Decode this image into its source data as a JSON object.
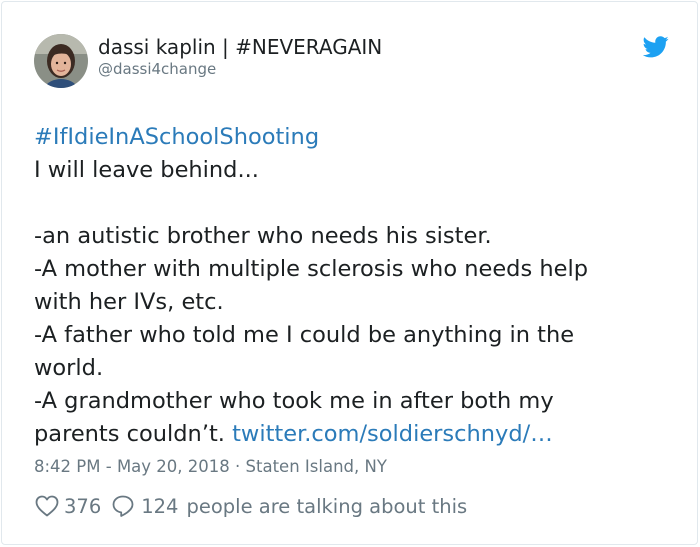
{
  "user": {
    "display_name": "dassi kaplin | #NEVERAGAIN",
    "handle": "@dassi4change"
  },
  "tweet": {
    "hashtag": "#IfIdieInASchoolShooting",
    "line1": "I will leave behind...",
    "line2": "-an autistic brother who needs his sister.",
    "line3": "-A mother with multiple sclerosis who needs help",
    "line4": "with her IVs, etc.",
    "line5": "-A father who told me I could be anything in the",
    "line6": "world.",
    "line7": "-A grandmother who took me in after both my",
    "line8_text": "parents couldn’t.",
    "link": "twitter.com/soldierschnyd/…"
  },
  "meta": {
    "time": "8:42 PM",
    "separator": " - ",
    "date": "May 20, 2018",
    "dot": " · ",
    "location": "Staten Island, NY"
  },
  "actions": {
    "like_count": "376",
    "reply_count": "124",
    "talking_text": "people are talking about this"
  },
  "icons": {
    "like": "heart-icon",
    "reply": "speech-bubble-icon",
    "brand": "twitter-bird-icon"
  },
  "colors": {
    "link": "#2b7bb9",
    "muted": "#697882",
    "text": "#1c2022",
    "brand": "#1da1f2",
    "border": "#e1e8ed"
  }
}
